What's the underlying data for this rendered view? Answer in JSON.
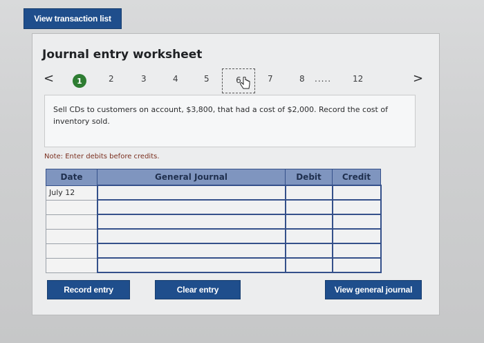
{
  "header": {
    "view_list_label": "View transaction list"
  },
  "worksheet": {
    "title": "Journal entry worksheet",
    "steps": [
      "1",
      "2",
      "3",
      "4",
      "5",
      "6",
      "7",
      "8",
      "12"
    ],
    "ellipsis": ".....",
    "prev_arrow": "<",
    "next_arrow": ">",
    "prompt": "Sell CDs to customers on account, $3,800, that had a cost of $2,000. Record the cost of inventory sold.",
    "note": "Note: Enter debits before credits."
  },
  "table": {
    "headers": [
      "Date",
      "General Journal",
      "Debit",
      "Credit"
    ],
    "rows": [
      [
        "July 12",
        "",
        "",
        ""
      ],
      [
        "",
        "",
        "",
        ""
      ],
      [
        "",
        "",
        "",
        ""
      ],
      [
        "",
        "",
        "",
        ""
      ],
      [
        "",
        "",
        "",
        ""
      ],
      [
        "",
        "",
        "",
        ""
      ]
    ]
  },
  "actions": {
    "record_label": "Record entry",
    "clear_label": "Clear entry",
    "general_label": "View general journal"
  },
  "colors": {
    "accent": "#1f4e8c",
    "active_step": "#2e7d32",
    "table_header": "#7f95bf"
  }
}
